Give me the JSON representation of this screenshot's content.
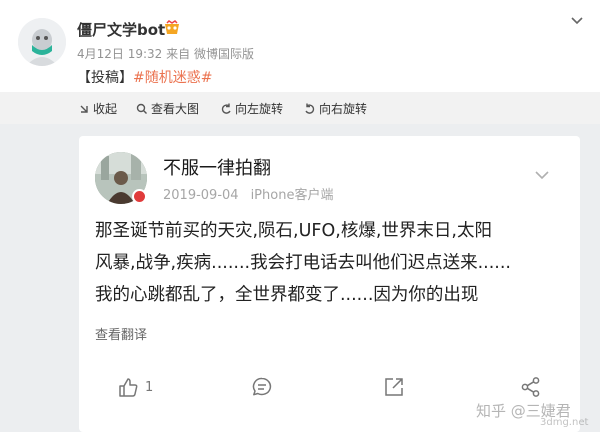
{
  "post": {
    "username": "僵尸文学bot",
    "date": "4月12日 19:32",
    "source_prefix": "来自",
    "source": "微博国际版",
    "text_prefix": "【投稿】",
    "hashtag": "#随机迷惑#"
  },
  "toolbar": {
    "collapse": "收起",
    "view_large": "查看大图",
    "rotate_left": "向左旋转",
    "rotate_right": "向右旋转"
  },
  "card": {
    "name": "不服一律拍翻",
    "date": "2019-09-04",
    "device": "iPhone客户端",
    "lines": [
      "那圣诞节前买的天灾,陨石,UFO,核爆,世界末日,太阳",
      "风暴,战争,疾病.......我会打电话去叫他们迟点送来......",
      "我的心跳都乱了，全世界都变了......因为你的出现"
    ],
    "translate": "查看翻译",
    "like_count": "1"
  },
  "watermark": {
    "text": "知乎 @三婕君",
    "sub": "3dmg.net"
  },
  "colors": {
    "hashtag": "#eb7350",
    "toolbar_bg": "#f2f2f2",
    "verify": "#e03b3b"
  },
  "icons": [
    "vip-icon",
    "chevron-down-icon",
    "collapse-icon",
    "zoom-icon",
    "rotate-left-icon",
    "rotate-right-icon",
    "like-icon",
    "comment-icon",
    "share-icon",
    "repost-icon"
  ]
}
